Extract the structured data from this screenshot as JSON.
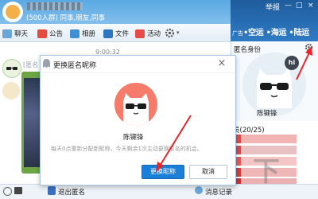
{
  "header": {
    "group_info": "(500人群) 同事,朋友,同事",
    "window_controls": [
      "举报",
      "—",
      "□",
      "×"
    ],
    "ad_label": "广告",
    "ad_text": "•空运 •海运 •陆运"
  },
  "toolbar": {
    "items": [
      {
        "label": "聊天"
      },
      {
        "label": "公告"
      },
      {
        "label": "相册"
      },
      {
        "label": "文件"
      },
      {
        "label": "活动"
      }
    ]
  },
  "chat": {
    "timestamp": "9:00:32",
    "sender_label": "[匿名"
  },
  "dialog": {
    "title": "更换匿名昵称",
    "close": "×",
    "anon_name": "陈键锋",
    "note": "每天0点重新分配新昵称，今天剩余1次主动更换匿名的机会。",
    "confirm_label": "更换昵称",
    "cancel_label": "取消"
  },
  "side_panel": {
    "title": "匿名身份",
    "badge": "hi",
    "anon_name": "陈键锋",
    "members_label": "员(20/25)"
  },
  "bottom": {
    "exit_anon": "退出匿名",
    "msg_log": "消息记录",
    "watermark": "下"
  },
  "colors": {
    "primary_button": "#1a7fd8",
    "avatar_bg": "#f57b6a",
    "header_blue": "#5aa9e3",
    "ad_blue": "#2f7bc4",
    "arrow_red": "#e6262b"
  }
}
